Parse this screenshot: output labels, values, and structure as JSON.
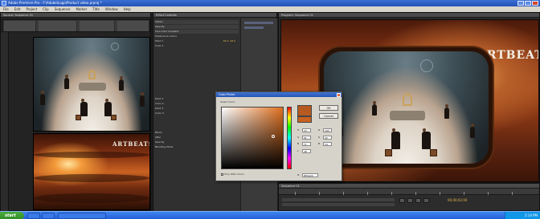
{
  "window": {
    "title": "Adobe Premiere Pro - F:\\Adobe\\Logo\\Product video.prproj *",
    "controls": [
      "minimize",
      "maximize",
      "close"
    ]
  },
  "menu": [
    "File",
    "Edit",
    "Project",
    "Clip",
    "Sequence",
    "Marker",
    "Title",
    "Window",
    "Help"
  ],
  "left_panel": {
    "tab": "Source: Sequence 01"
  },
  "effects_panel": {
    "tab": "Effect Controls",
    "rows": [
      {
        "label": "Motion",
        "value": ""
      },
      {
        "label": "Opacity",
        "value": ""
      },
      {
        "label": "Four-Color Gradient",
        "value": ""
      },
      {
        "label": "Positions & Colors",
        "value": ""
      },
      {
        "label": "Point 1",
        "value": "65.0, 48.0"
      },
      {
        "label": "Color 1",
        "value": ""
      },
      {
        "label": "Point 2",
        "value": "653.0, 48.0"
      },
      {
        "label": "Color 2",
        "value": ""
      },
      {
        "label": "Point 3",
        "value": "65.0, 432.0"
      },
      {
        "label": "Color 3",
        "value": ""
      },
      {
        "label": "Blend",
        "value": "100.0"
      },
      {
        "label": "Jitter",
        "value": "0.0 %"
      },
      {
        "label": "Opacity",
        "value": "100.0 %"
      },
      {
        "label": "Blending Mode",
        "value": "Normal"
      }
    ]
  },
  "program_panel": {
    "tab": "Program: Sequence 01",
    "watermark": "ARTBEATS"
  },
  "timeline_panel": {
    "tab": "Sequence 01",
    "timecode": "00;00;02;00"
  },
  "color_picker": {
    "title": "Color Picker",
    "label": "Select Color:",
    "ok_label": "OK",
    "cancel_label": "Cancel",
    "fields": [
      {
        "key": "H",
        "value": "23",
        "key2": "R",
        "value2": "182"
      },
      {
        "key": "S",
        "value": "81",
        "key2": "G",
        "value2": "90"
      },
      {
        "key": "B",
        "value": "71",
        "key2": "B",
        "value2": "34"
      },
      {
        "key": "L",
        "value": "48",
        "key2": "",
        "value2": ""
      }
    ],
    "hex_label": "#",
    "hex_value": "B65A22",
    "web_only": "Only Web Colors",
    "selected_color": "#b65a22",
    "previous_color": "#c9611f"
  },
  "taskbar": {
    "start_label": "start",
    "clock": "2:14 PM"
  },
  "stage_watermark": "ARTBEATS"
}
